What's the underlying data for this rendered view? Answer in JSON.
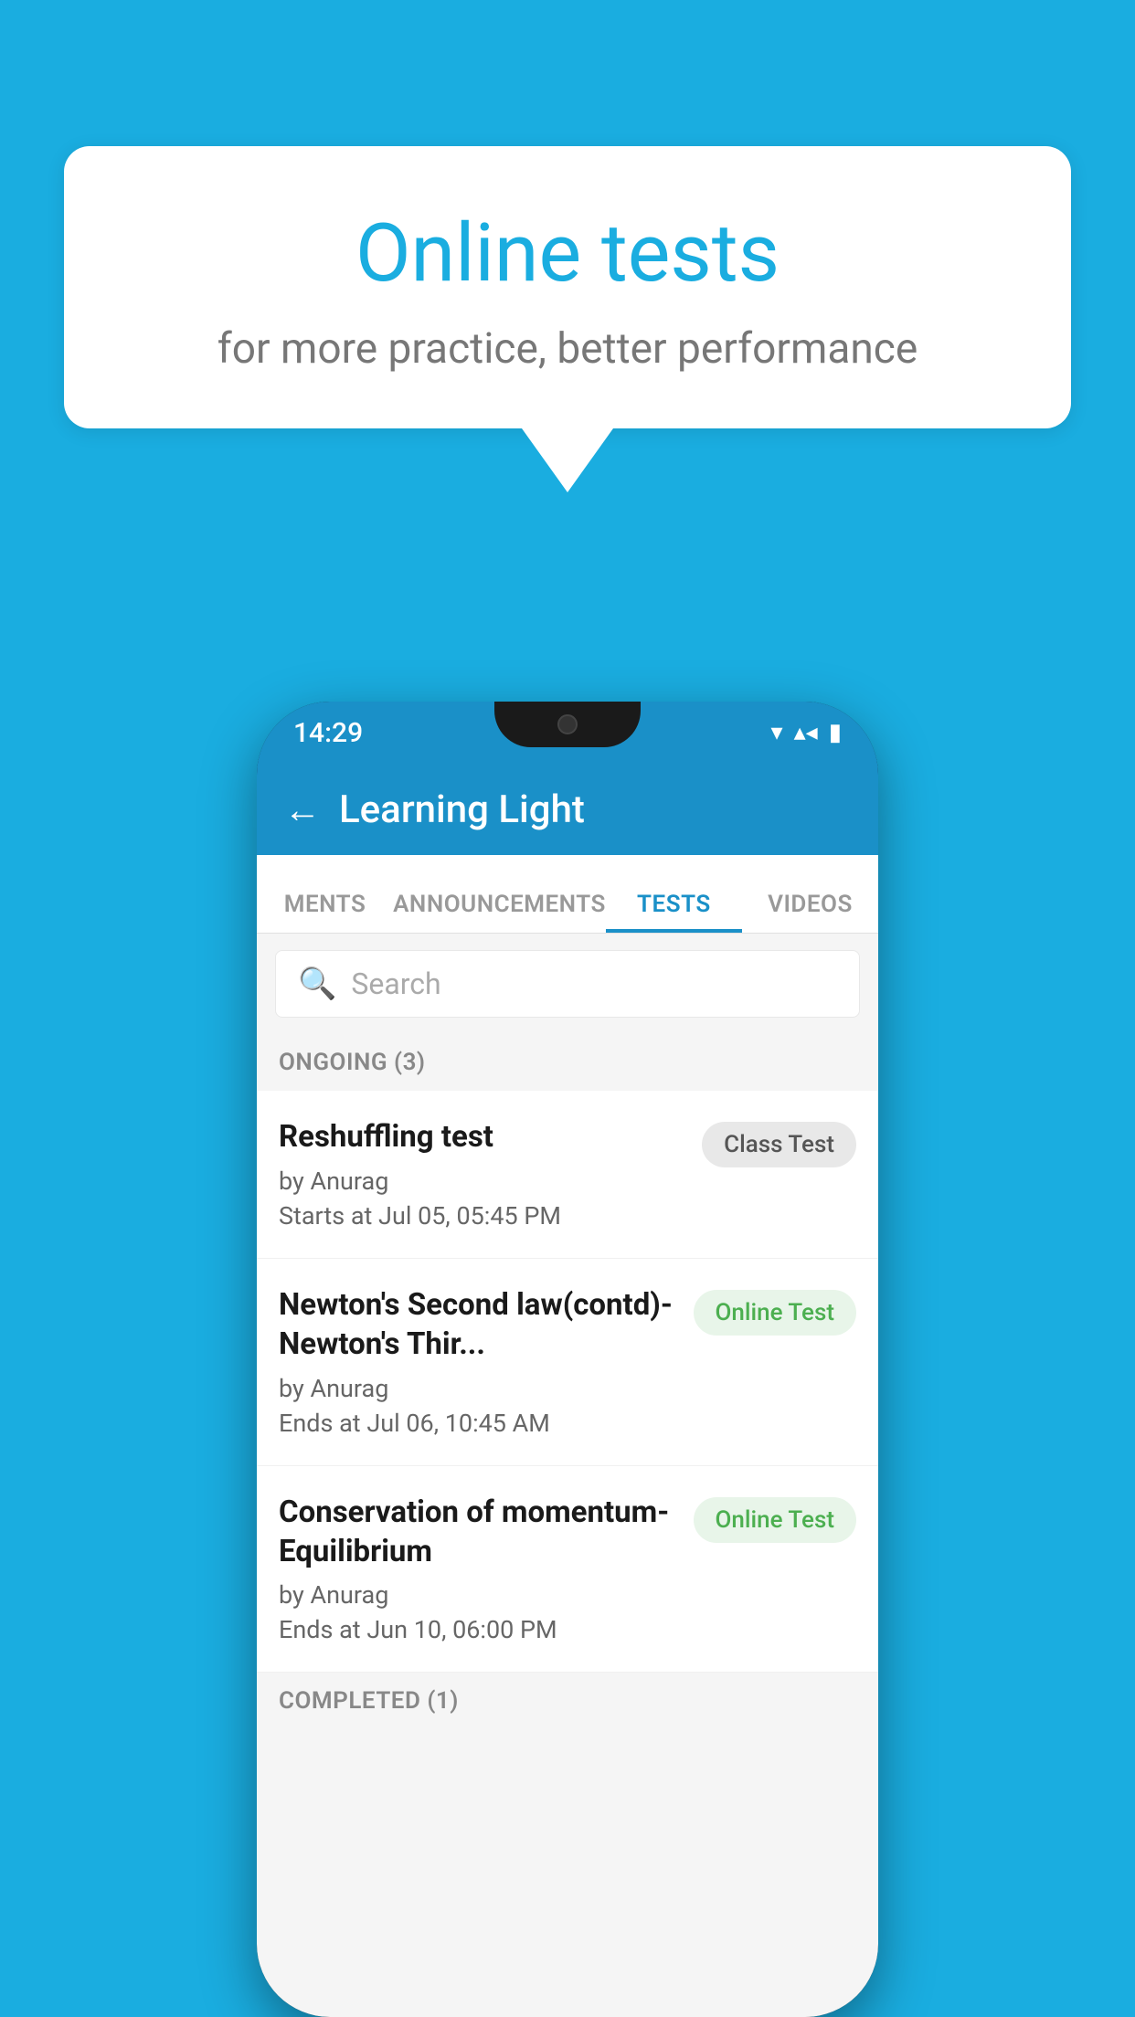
{
  "background": {
    "color": "#1AADE0"
  },
  "speech_bubble": {
    "title": "Online tests",
    "subtitle": "for more practice, better performance"
  },
  "phone": {
    "status_bar": {
      "time": "14:29",
      "wifi_icon": "▼",
      "signal_icon": "▲",
      "battery_icon": "▌"
    },
    "app_header": {
      "back_label": "←",
      "title": "Learning Light"
    },
    "tabs": [
      {
        "label": "MENTS",
        "active": false
      },
      {
        "label": "ANNOUNCEMENTS",
        "active": false
      },
      {
        "label": "TESTS",
        "active": true
      },
      {
        "label": "VIDEOS",
        "active": false
      }
    ],
    "search": {
      "placeholder": "Search"
    },
    "ongoing_section": {
      "label": "ONGOING (3)"
    },
    "test_items": [
      {
        "name": "Reshuffling test",
        "author": "by Anurag",
        "date": "Starts at  Jul 05, 05:45 PM",
        "badge": "Class Test",
        "badge_type": "class"
      },
      {
        "name": "Newton's Second law(contd)-Newton's Thir...",
        "author": "by Anurag",
        "date": "Ends at  Jul 06, 10:45 AM",
        "badge": "Online Test",
        "badge_type": "online"
      },
      {
        "name": "Conservation of momentum-Equilibrium",
        "author": "by Anurag",
        "date": "Ends at  Jun 10, 06:00 PM",
        "badge": "Online Test",
        "badge_type": "online"
      }
    ],
    "completed_section": {
      "label": "COMPLETED (1)"
    }
  }
}
